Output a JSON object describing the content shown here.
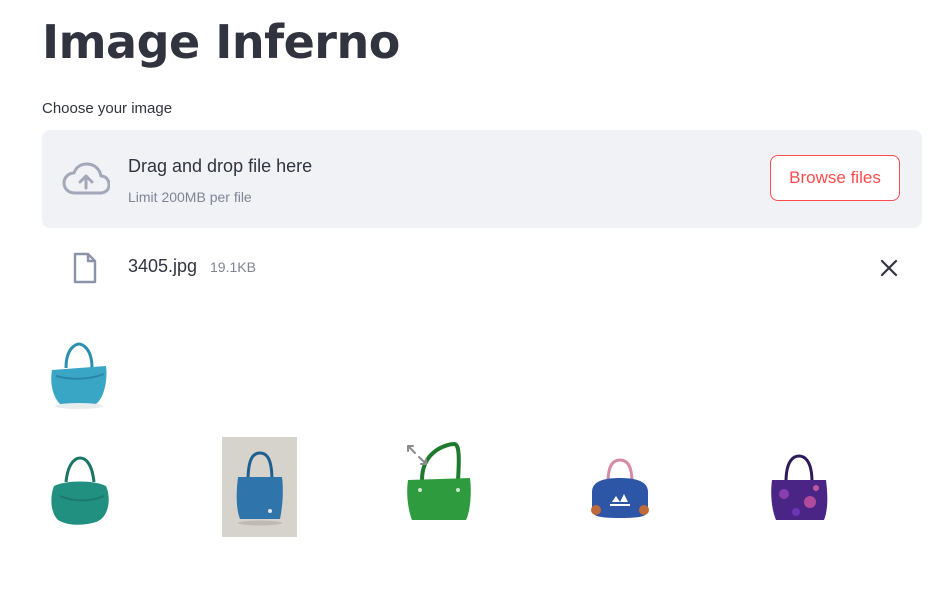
{
  "page": {
    "title": "Image Inferno"
  },
  "uploader": {
    "label": "Choose your image",
    "drop_text": "Drag and drop file here",
    "limit_text": "Limit 200MB per file",
    "browse_label": "Browse files",
    "icon": "cloud-upload-icon"
  },
  "uploaded_file": {
    "name": "3405.jpg",
    "size": "19.1KB",
    "icon": "file-icon",
    "remove_icon": "close-icon"
  },
  "query_image": {
    "subject": "teal blue tote handbag"
  },
  "results": [
    {
      "subject": "teal green hobo bag",
      "color": "#1f8a7a"
    },
    {
      "subject": "blue tote bag on grey background",
      "color": "#2f6fa5"
    },
    {
      "subject": "green shoulder bag",
      "color": "#2c9a3a"
    },
    {
      "subject": "blue adidas duffel bag",
      "color": "#2d56a6"
    },
    {
      "subject": "purple patterned tote bag",
      "color": "#5a2c8a"
    }
  ],
  "colors": {
    "accent": "#ff4b4b",
    "text": "#31333f",
    "muted": "#808495",
    "dropzone_bg": "#f0f2f6"
  }
}
